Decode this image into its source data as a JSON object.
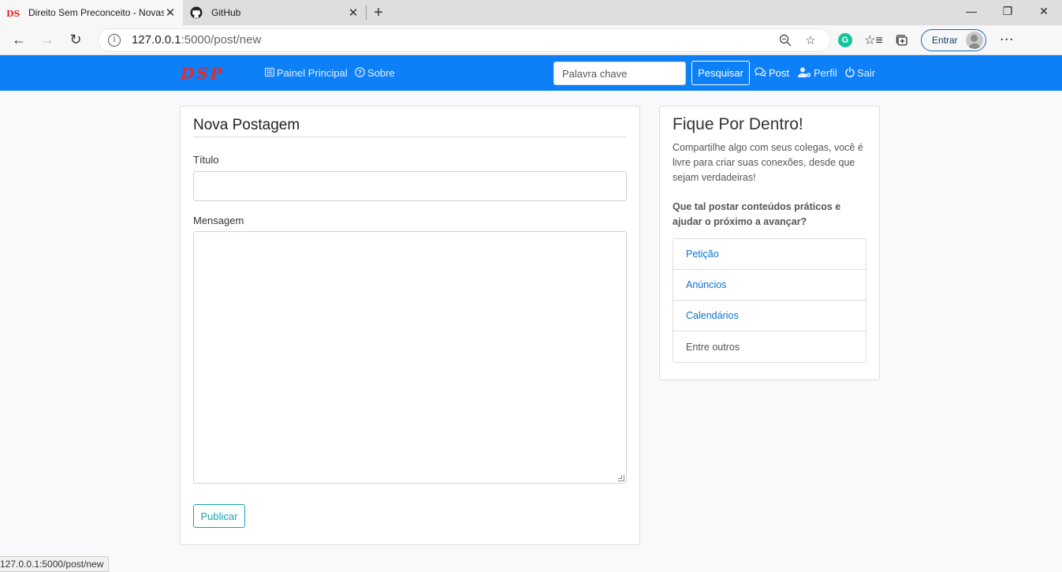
{
  "browser": {
    "tabs": [
      {
        "title": "Direito Sem Preconceito - Novas",
        "favicon": "DSP",
        "active": true
      },
      {
        "title": "GitHub",
        "favicon": "github-icon",
        "active": false
      }
    ],
    "url_host": "127.0.0.1",
    "url_path": ":5000/post/new",
    "signin_label": "Entrar",
    "status_url": "127.0.0.1:5000/post/new"
  },
  "navbar": {
    "brand": "DSP",
    "links": [
      {
        "label": "Painel Principal",
        "icon": "list-icon"
      },
      {
        "label": "Sobre",
        "icon": "question-circle-icon"
      }
    ],
    "search_placeholder": "Palavra chave",
    "search_button": "Pesquisar",
    "right_links": [
      {
        "label": "Post",
        "icon": "comments-icon"
      },
      {
        "label": "Perfil",
        "icon": "user-cog-icon"
      },
      {
        "label": "Sair",
        "icon": "power-icon"
      }
    ],
    "color": "#0d80f8"
  },
  "form": {
    "legend": "Nova Postagem",
    "title_label": "Título",
    "title_value": "",
    "message_label": "Mensagem",
    "message_value": "",
    "submit_label": "Publicar"
  },
  "sidebar": {
    "title": "Fique Por Dentro!",
    "text": "Compartilhe algo com seus colegas, você é livre para criar suas conexões, desde que sejam verdadeiras!",
    "bold_text": "Que tal postar conteúdos práticos e ajudar o próximo a avançar?",
    "items": [
      {
        "label": "Petição"
      },
      {
        "label": "Anúncios"
      },
      {
        "label": "Calendários"
      },
      {
        "label": "Entre outros"
      }
    ]
  }
}
